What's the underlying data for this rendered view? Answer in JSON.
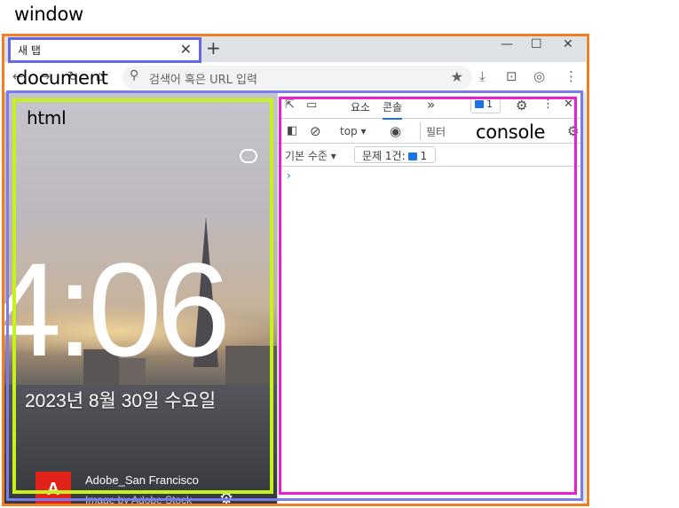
{
  "annotations": {
    "window": "window",
    "document": "document",
    "html": "html",
    "console": "console",
    "colors": {
      "window": "#f07f21",
      "document": "#7b7bf0",
      "html": "#c5f21c",
      "console": "#ea1fd0",
      "tab": "#6565ee"
    }
  },
  "browser": {
    "tab_title": "새 탭",
    "tab_close": "✕",
    "new_tab": "+",
    "window_controls": {
      "minimize": "—",
      "maximize": "☐",
      "close": "✕"
    },
    "nav_icons": [
      "back-icon",
      "forward-icon",
      "reload-icon",
      "home-icon"
    ],
    "omnibox_placeholder": "검색어 혹은 URL 입력",
    "toolbar_icons": [
      "star-icon",
      "download-icon",
      "screenshot-icon",
      "profile-icon",
      "menu-icon"
    ]
  },
  "page": {
    "time": "4:06",
    "date": "2023년 8월 30일 수요일",
    "credit_title": "Adobe_San Francisco",
    "credit_sub": "Image by Adobe Stock",
    "logo_text": "A"
  },
  "devtools": {
    "tabs": [
      "요소",
      "콘솔"
    ],
    "active_tab": "콘솔",
    "more_tabs": "»",
    "issue_count": "1",
    "context": "top",
    "filter_placeholder": "필터",
    "log_level": "기본 수준",
    "issues_label": "문제 1건:",
    "issues_count": "1",
    "prompt": "›"
  }
}
